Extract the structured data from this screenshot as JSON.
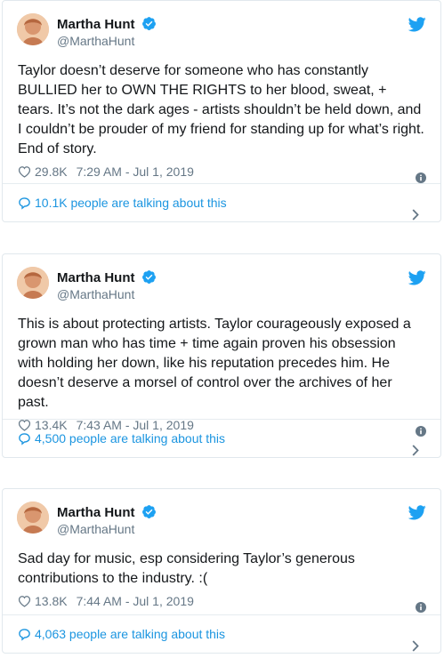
{
  "tweets": [
    {
      "author_name": "Martha Hunt",
      "author_handle": "@MarthaHunt",
      "text": "Taylor doesn’t deserve for someone who has constantly BULLIED her to OWN THE RIGHTS to her blood, sweat, + tears. It’s not the dark ages - artists shouldn’t be held down, and I couldn’t be prouder of my friend for standing up for what’s right. End of story.",
      "likes": "29.8K",
      "timestamp": "7:29 AM - Jul 1, 2019",
      "talking": "10.1K people are talking about this"
    },
    {
      "author_name": "Martha Hunt",
      "author_handle": "@MarthaHunt",
      "text": "This is about protecting artists. Taylor courageously exposed a grown man who has time + time again proven his obsession with holding her down, like his reputation precedes him. He doesn’t deserve a morsel of control over the archives of her past.",
      "likes": "13.4K",
      "timestamp": "7:43 AM - Jul 1, 2019",
      "talking": "4,500 people are talking about this"
    },
    {
      "author_name": "Martha Hunt",
      "author_handle": "@MarthaHunt",
      "text": "Sad day for music, esp considering Taylor’s generous contributions to the industry. :(",
      "likes": "13.8K",
      "timestamp": "7:44 AM - Jul 1, 2019",
      "talking": "4,063 people are talking about this"
    }
  ],
  "icons": {
    "verified": "verified-badge-icon",
    "bird": "twitter-bird-icon",
    "heart": "heart-icon",
    "info": "info-icon",
    "reply_bubble": "speech-bubble-icon",
    "chevron": "chevron-right-icon"
  },
  "colors": {
    "brand_blue": "#1da1f2",
    "link_blue": "#1b95e0",
    "muted_gray": "#657786",
    "border": "#e1e8ed"
  }
}
